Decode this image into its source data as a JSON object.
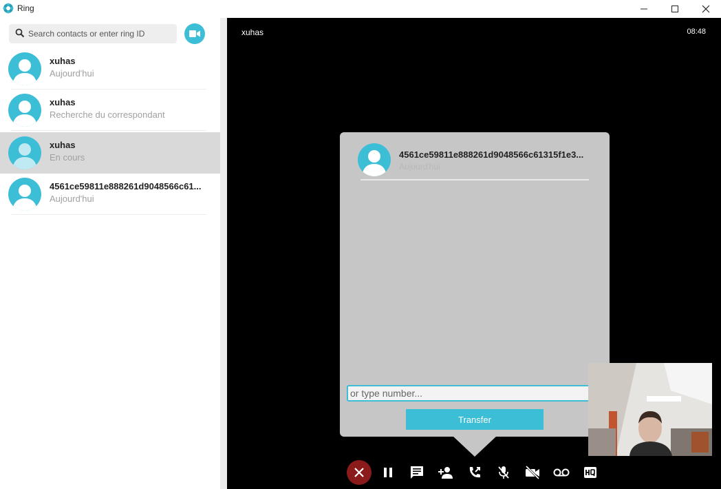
{
  "app": {
    "title": "Ring",
    "accent": "#3cbfd6",
    "hangup_color": "#8b1a1a"
  },
  "window_controls": [
    "minimize-icon",
    "maximize-icon",
    "close-icon"
  ],
  "search": {
    "placeholder": "Search contacts or enter ring ID",
    "value": ""
  },
  "contacts": [
    {
      "name": "xuhas",
      "status": "Aujourd'hui",
      "selected": false
    },
    {
      "name": "xuhas",
      "status": "Recherche du correspondant",
      "selected": false
    },
    {
      "name": "xuhas",
      "status": "En cours",
      "selected": true
    },
    {
      "name": "4561ce59811e888261d9048566c61...",
      "status": "Aujourd'hui",
      "selected": false
    }
  ],
  "call": {
    "peer_name": "xuhas",
    "time": "08:48"
  },
  "transfer": {
    "contact_name": "4561ce59811e888261d9048566c61315f1e3...",
    "contact_status": "Aujourd'hui",
    "number_placeholder": "or type number...",
    "number_value": "",
    "button_label": "Transfer"
  },
  "controls": [
    "hangup-icon",
    "pause-icon",
    "chat-icon",
    "add-participant-icon",
    "transfer-call-icon",
    "mute-mic-icon",
    "video-off-icon",
    "voicemail-record-icon",
    "hq-quality-icon"
  ]
}
